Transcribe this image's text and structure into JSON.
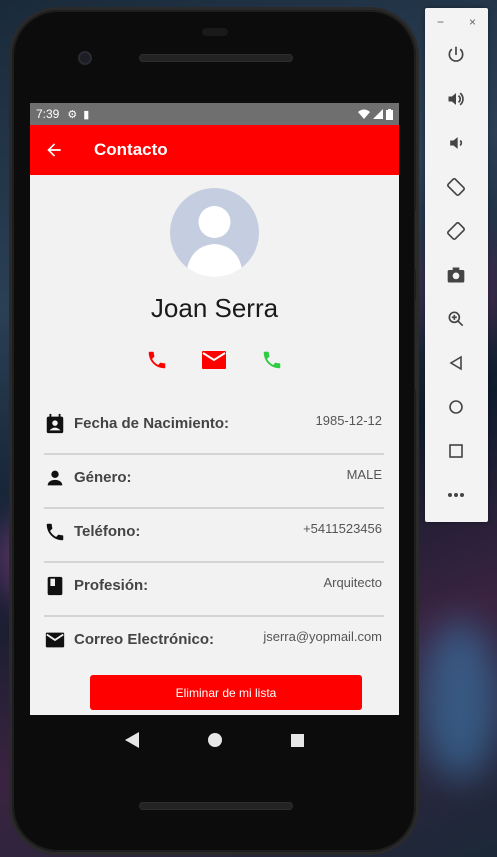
{
  "status_bar": {
    "time": "7:39"
  },
  "app_bar": {
    "title": "Contacto"
  },
  "contact": {
    "name": "Joan Serra"
  },
  "details": [
    {
      "label": "Fecha de Nacimiento:",
      "value": "1985-12-12",
      "icon": "calendar-icon"
    },
    {
      "label": "Género:",
      "value": "MALE",
      "icon": "person-icon"
    },
    {
      "label": "Teléfono:",
      "value": "+5411523456",
      "icon": "phone-icon"
    },
    {
      "label": "Profesión:",
      "value": "Arquitecto",
      "icon": "book-icon"
    },
    {
      "label": "Correo Electrónico:",
      "value": "jserra@yopmail.com",
      "icon": "mail-icon"
    }
  ],
  "delete_button": {
    "label": "Eliminar de mi lista"
  },
  "colors": {
    "accent": "#ff0000",
    "call_green": "#2ecc40"
  },
  "toolbar": {
    "minimize": "−",
    "close": "×"
  }
}
